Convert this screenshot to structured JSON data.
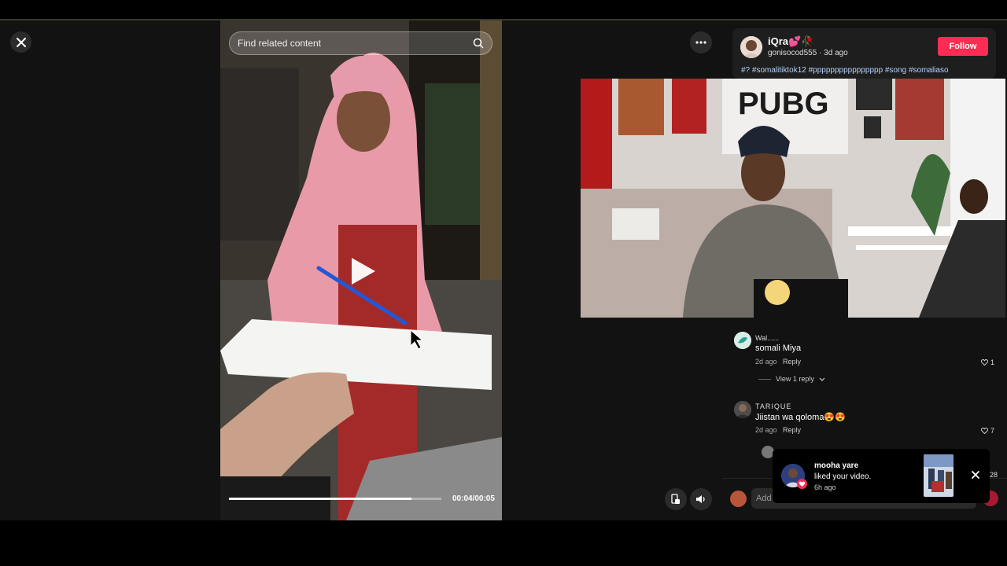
{
  "video": {
    "search_placeholder": "Find related content",
    "time": "00:04/00:05",
    "progress_fraction": 0.86
  },
  "author": {
    "display_name": "iQra💕🥀",
    "meta": "gonisocod555 · 3d ago",
    "follow_label": "Follow",
    "hashtags": "#? #somalitiktok12 #pppppppppppppppp #song #somaliaso"
  },
  "comments": [
    {
      "name": "Wal......",
      "text": "somali Miya",
      "time": "2d ago",
      "reply_label": "Reply",
      "likes": "1"
    },
    {
      "name": "TARIQUE",
      "text": "Jiistan wa qoloma😍😍",
      "time": "2d ago",
      "reply_label": "Reply",
      "likes": "7"
    }
  ],
  "view_replies_label": "View 1 reply",
  "comment_input_placeholder": "Add comment...",
  "toast": {
    "title": "mooha yare",
    "message": "liked your video.",
    "time": "6h ago",
    "side_count": "28"
  },
  "icons": {
    "close": "close-icon",
    "search": "search-icon",
    "more": "more-icon",
    "play": "play-icon",
    "volume": "volume-icon",
    "pip": "floating-player-icon",
    "heart": "heart-icon"
  },
  "colors": {
    "accent": "#fe2c55",
    "hashtag": "#b3d4ff"
  }
}
